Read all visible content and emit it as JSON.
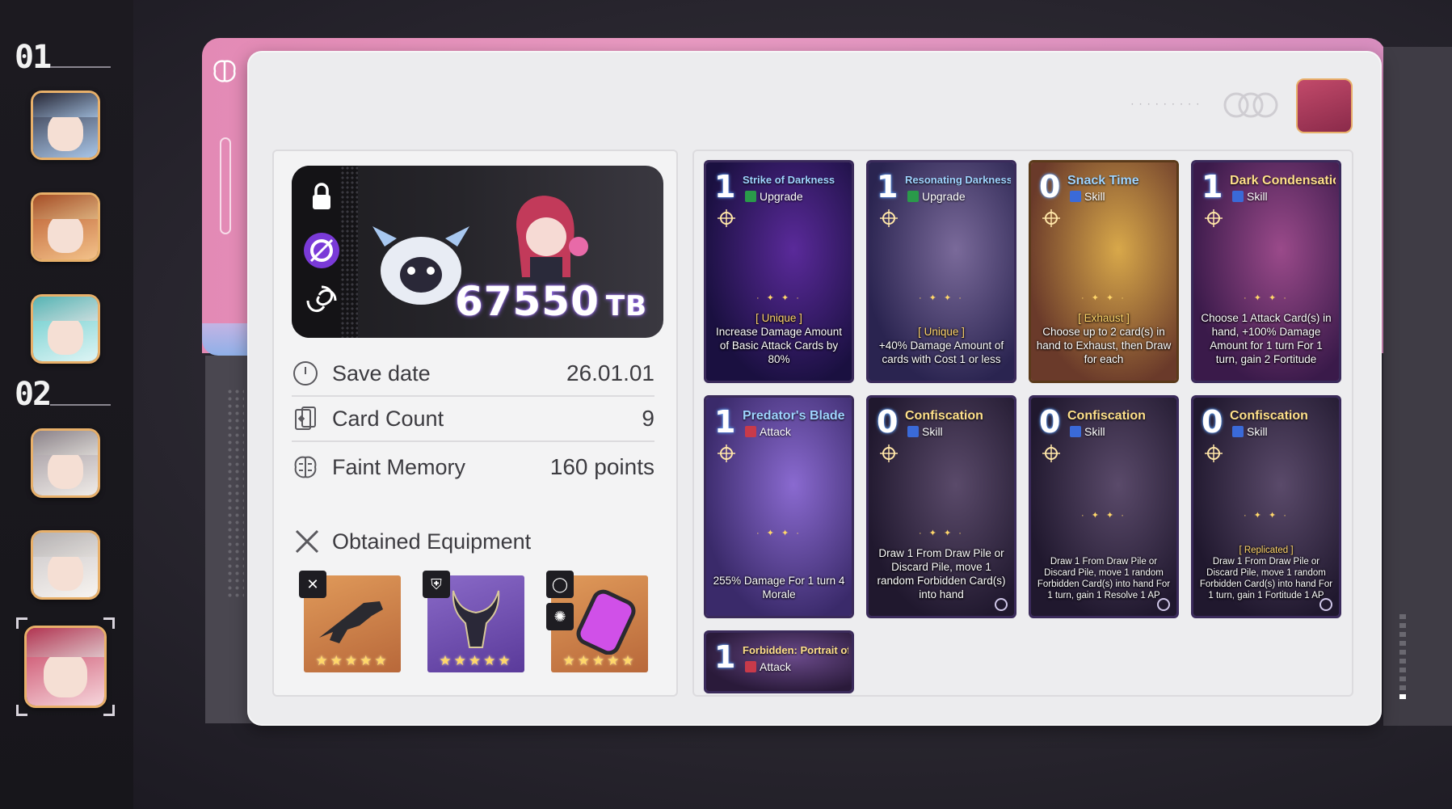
{
  "sidebar": {
    "groups": [
      {
        "label": "01"
      },
      {
        "label": "02"
      }
    ],
    "avatars": [
      {
        "name": "character-1",
        "colors": [
          "#2a2a3a",
          "#a9c6e8"
        ]
      },
      {
        "name": "character-2",
        "colors": [
          "#b8562a",
          "#f3c28a"
        ]
      },
      {
        "name": "character-3",
        "colors": [
          "#5fc8c8",
          "#dff5f5"
        ]
      },
      {
        "name": "character-4",
        "colors": [
          "#9a9098",
          "#f0ece8"
        ]
      },
      {
        "name": "character-5",
        "colors": [
          "#c8c4c6",
          "#f8f4f0"
        ]
      },
      {
        "name": "character-6",
        "colors": [
          "#c53a5a",
          "#f6d6dc"
        ],
        "selected": true
      }
    ]
  },
  "summary": {
    "score": "67550",
    "score_unit": "TB",
    "rows": [
      {
        "label": "Save date",
        "value": "26.01.01",
        "icon": "clock-icon"
      },
      {
        "label": "Card Count",
        "value": "9",
        "icon": "card-icon"
      },
      {
        "label": "Faint Memory",
        "value": "160 points",
        "icon": "brain-icon"
      }
    ],
    "equipment_title": "Obtained Equipment",
    "equipment": [
      {
        "name": "rifle",
        "stars": "★★★★★",
        "bg": "#d4824a",
        "tag": "✕",
        "icon": "swords-icon"
      },
      {
        "name": "horned-helm",
        "stars": "★★★★★",
        "bg": "#7a5ab0",
        "tag": "⛨",
        "icon": "armor-icon"
      },
      {
        "name": "canister",
        "stars": "★★★★★",
        "bg": "#d4824a",
        "tag": "◯",
        "icon": "ring-icon"
      }
    ]
  },
  "cards": [
    {
      "cost": "1",
      "name": "Strike of Darkness",
      "type": "Upgrade",
      "name_color": "blue",
      "keyword": "[ Unique ]",
      "desc": "Increase Damage Amount of Basic Attack Cards by 80%",
      "frame": "purple",
      "art": [
        "#1a1040",
        "#5a2a9a"
      ]
    },
    {
      "cost": "1",
      "name": "Resonating Darkness",
      "type": "Upgrade",
      "name_color": "blue",
      "keyword": "[ Unique ]",
      "desc": "+40% Damage Amount of cards with Cost 1 or less",
      "frame": "purple",
      "art": [
        "#2a2450",
        "#7a6a9a"
      ]
    },
    {
      "cost": "0",
      "name": "Snack Time",
      "type": "Skill",
      "name_color": "blue",
      "keyword": "[ Exhaust ]",
      "desc": "Choose up to 2 card(s) in hand to Exhaust, then Draw for each",
      "frame": "orange",
      "art": [
        "#6a3a2a",
        "#d8a84a"
      ]
    },
    {
      "cost": "1",
      "name": "Dark Condensation",
      "type": "Skill",
      "name_color": "yellow",
      "keyword": "",
      "desc": "Choose 1 Attack Card(s) in hand, +100% Damage Amount for 1 turn For 1 turn, gain 2 Fortitude",
      "frame": "purple",
      "art": [
        "#3a1a4a",
        "#9a4a8a"
      ]
    },
    {
      "cost": "1",
      "name": "Predator's Blade",
      "type": "Attack",
      "name_color": "blue",
      "keyword": "",
      "desc": "255% Damage For 1 turn 4 Morale",
      "frame": "purple",
      "art": [
        "#3a2a6a",
        "#8a6ad0"
      ]
    },
    {
      "cost": "0",
      "name": "Confiscation",
      "type": "Skill",
      "name_color": "yellow",
      "keyword": "",
      "desc": "Draw 1 From Draw Pile or Discard Pile, move 1 random Forbidden Card(s) into hand",
      "frame": "purple",
      "art": [
        "#20182e",
        "#5a4a6a"
      ]
    },
    {
      "cost": "0",
      "name": "Confiscation",
      "type": "Skill",
      "name_color": "yellow",
      "keyword": "",
      "desc": "Draw 1 From Draw Pile or Discard Pile, move 1 random Forbidden Card(s) into hand For 1 turn, gain 1 Resolve 1 AP",
      "frame": "purple",
      "art": [
        "#20182e",
        "#5a4a6a"
      ]
    },
    {
      "cost": "0",
      "name": "Confiscation",
      "type": "Skill",
      "name_color": "yellow",
      "keyword": "[ Replicated ]",
      "desc": "Draw 1 From Draw Pile or Discard Pile, move 1 random Forbidden Card(s) into hand For 1 turn, gain 1 Fortitude 1 AP",
      "frame": "purple",
      "art": [
        "#20182e",
        "#5a4a6a"
      ]
    },
    {
      "cost": "1",
      "name": "Forbidden: Portrait of Fury",
      "type": "Attack",
      "name_color": "yellow",
      "keyword": "",
      "desc": "",
      "frame": "purple",
      "art": [
        "#2a1a3a",
        "#6a4a8a"
      ]
    }
  ],
  "colors": {
    "accent_pink": "#e38ab5",
    "panel_bg": "#ececee",
    "upgrade_icon": "#2a9a4a",
    "skill_icon": "#3a6ad8",
    "attack_icon": "#c83a4a"
  }
}
